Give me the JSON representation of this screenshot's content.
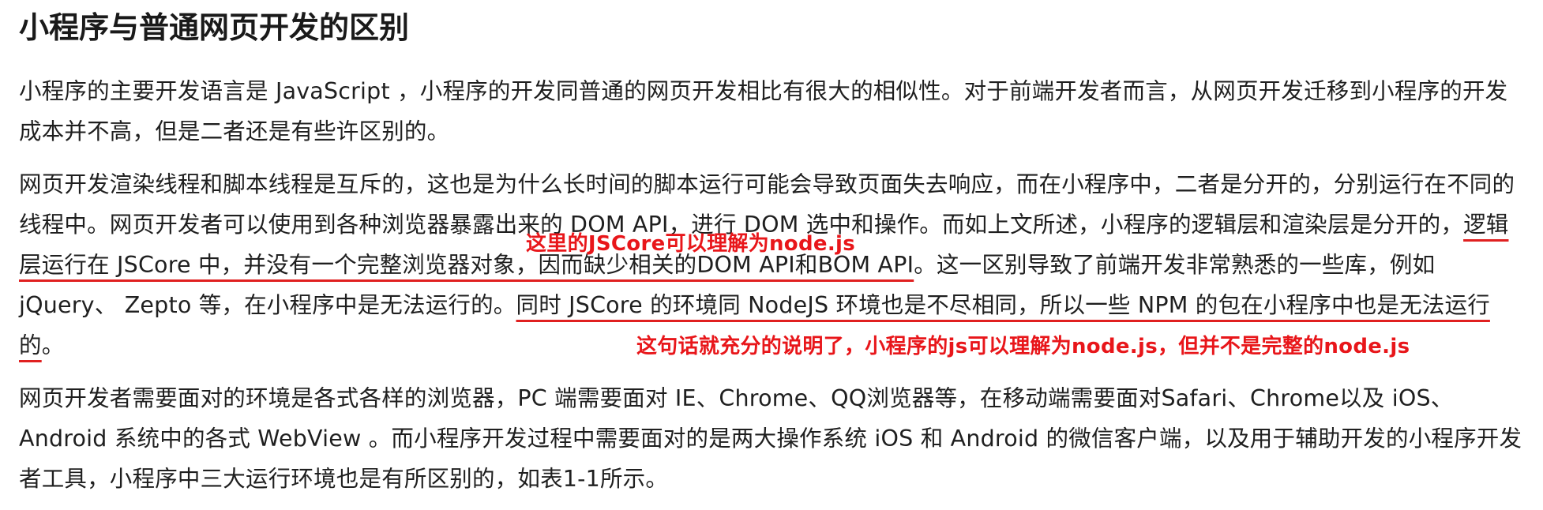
{
  "heading": "小程序与普通网页开发的区别",
  "paragraph1": "小程序的主要开发语言是 JavaScript ，小程序的开发同普通的网页开发相比有很大的相似性。对于前端开发者而言，从网页开发迁移到小程序的开发成本并不高，但是二者还是有些许区别的。",
  "paragraph2": {
    "part1": "网页开发渲染线程和脚本线程是互斥的，这也是为什么长时间的脚本运行可能会导致页面失去响应，而在小程序中，二者是分开的，分别运行在不同的线程中。网页开发者可以使用到各种浏览器暴露出来的 DOM API，进行 DOM 选中和操作。而如上文所述，小程序的逻辑层和渲染层是分开的，",
    "highlight1": "逻辑层运行在 JSCore 中，并没有一个完整浏览器对象，因而缺少相关的DOM API和BOM API",
    "part2": "。这一区别导致了前端开发非常熟悉的一些库，例如 jQuery、 Zepto 等，在小程序中是无法运行的。",
    "highlight2": "同时 JSCore 的环境同 NodeJS 环境也是不尽相同，所以一些 NPM 的包在小程序中也是无法运行的",
    "part3": "。"
  },
  "paragraph3": "网页开发者需要面对的环境是各式各样的浏览器，PC 端需要面对 IE、Chrome、QQ浏览器等，在移动端需要面对Safari、Chrome以及 iOS、Android 系统中的各式 WebView 。而小程序开发过程中需要面对的是两大操作系统 iOS 和 Android 的微信客户端，以及用于辅助开发的小程序开发者工具，小程序中三大运行环境也是有所区别的，如表1-1所示。",
  "annotations": {
    "note1": "这里的JSCore可以理解为node.js",
    "note2": "这句话就充分的说明了，小程序的js可以理解为node.js，但并不是完整的node.js"
  },
  "colors": {
    "annotation": "#e8161a",
    "underline": "#e02020",
    "text": "#1f1f1f"
  }
}
